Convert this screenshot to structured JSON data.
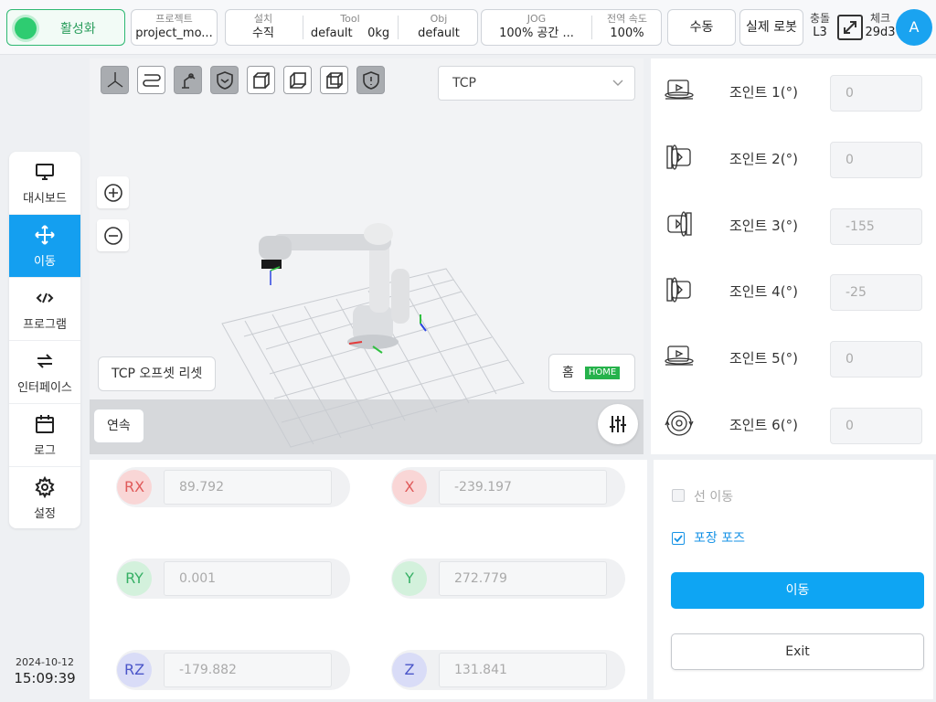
{
  "topbar": {
    "activate_label": "활성화",
    "project_header": "프로젝트",
    "project_value": "project_mo...",
    "install_header": "설치",
    "install_value": "수직",
    "tool_header": "Tool",
    "tool_value": "default",
    "tool_weight": "0kg",
    "obj_header": "Obj",
    "obj_value": "default",
    "jog_header": "JOG",
    "jog_value": "100%  공간 ...",
    "global_speed_header": "전역 속도",
    "global_speed_value": "100%",
    "manual_label": "수동",
    "real_robot_label": "실제 로봇",
    "collision_header": "충돌",
    "collision_value": "L3",
    "check_header": "체크",
    "check_value": "29d3",
    "avatar_letter": "A"
  },
  "nav": {
    "items": [
      {
        "label": "대시보드",
        "icon": "monitor-icon"
      },
      {
        "label": "이동",
        "icon": "move-icon"
      },
      {
        "label": "프로그램",
        "icon": "code-icon"
      },
      {
        "label": "인터페이스",
        "icon": "swap-icon"
      },
      {
        "label": "로그",
        "icon": "calendar-icon"
      },
      {
        "label": "설정",
        "icon": "gear-icon"
      }
    ],
    "active": "이동"
  },
  "datetime": {
    "date": "2024-10-12",
    "time": "15:09:39"
  },
  "viewport": {
    "coordinate_select": "TCP",
    "tcp_offset_reset_label": "TCP 오프셋 리셋",
    "home_label": "홈",
    "home_badge": "HOME",
    "continuous_label": "연속"
  },
  "joints": [
    {
      "label": "조인트 1(°)",
      "value": "0"
    },
    {
      "label": "조인트 2(°)",
      "value": "0"
    },
    {
      "label": "조인트 3(°)",
      "value": "-155"
    },
    {
      "label": "조인트 4(°)",
      "value": "-25"
    },
    {
      "label": "조인트 5(°)",
      "value": "0"
    },
    {
      "label": "조인트 6(°)",
      "value": "0"
    }
  ],
  "pose": {
    "rx": {
      "label": "RX",
      "value": "89.792"
    },
    "ry": {
      "label": "RY",
      "value": "0.001"
    },
    "rz": {
      "label": "RZ",
      "value": "-179.882"
    },
    "x": {
      "label": "X",
      "value": "-239.197"
    },
    "y": {
      "label": "Y",
      "value": "272.779"
    },
    "z": {
      "label": "Z",
      "value": "131.841"
    }
  },
  "move_panel": {
    "linear_move_label": "선 이동",
    "linear_move_checked": false,
    "packing_pose_label": "포장 포즈",
    "packing_pose_checked": true,
    "move_button": "이동",
    "exit_button": "Exit"
  },
  "colors": {
    "accent": "#0ea5f3",
    "active_green": "#2ecc71",
    "rx_badge": "#f9d6d6",
    "ry_badge": "#d3f1dc",
    "rz_badge": "#d9dcf7"
  }
}
